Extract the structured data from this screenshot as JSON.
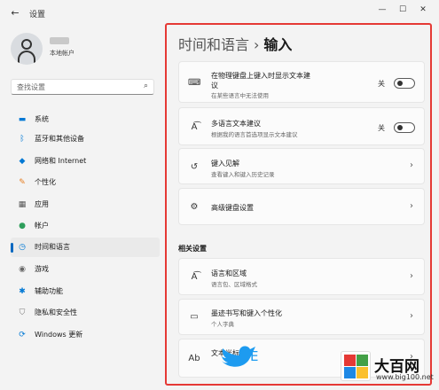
{
  "window": {
    "title": "设置",
    "back_glyph": "←",
    "minimize": "—",
    "maximize": "☐",
    "close": "✕"
  },
  "profile": {
    "sub_label": "本地帐户"
  },
  "search": {
    "placeholder": "查找设置"
  },
  "nav": [
    {
      "label": "系统",
      "icon": "monitor-icon",
      "glyph": "▬",
      "color": "#0078d4",
      "active": false
    },
    {
      "label": "蓝牙和其他设备",
      "icon": "bluetooth-icon",
      "glyph": "ᛒ",
      "color": "#0078d4",
      "active": false
    },
    {
      "label": "网络和 Internet",
      "icon": "wifi-icon",
      "glyph": "◆",
      "color": "#0078d4",
      "active": false
    },
    {
      "label": "个性化",
      "icon": "brush-icon",
      "glyph": "✎",
      "color": "#e67e22",
      "active": false
    },
    {
      "label": "应用",
      "icon": "apps-icon",
      "glyph": "▦",
      "color": "#555555",
      "active": false
    },
    {
      "label": "帐户",
      "icon": "person-icon",
      "glyph": "●",
      "color": "#2e9e5b",
      "active": false
    },
    {
      "label": "时间和语言",
      "icon": "clock-globe-icon",
      "glyph": "◷",
      "color": "#0078d4",
      "active": true
    },
    {
      "label": "游戏",
      "icon": "gamepad-icon",
      "glyph": "◉",
      "color": "#666666",
      "active": false
    },
    {
      "label": "辅助功能",
      "icon": "accessibility-icon",
      "glyph": "✱",
      "color": "#0078d4",
      "active": false
    },
    {
      "label": "隐私和安全性",
      "icon": "shield-icon",
      "glyph": "⛉",
      "color": "#777777",
      "active": false
    },
    {
      "label": "Windows 更新",
      "icon": "update-icon",
      "glyph": "⟳",
      "color": "#0078d4",
      "active": false
    }
  ],
  "breadcrumb": {
    "parent": "时间和语言",
    "separator": "›",
    "current": "输入"
  },
  "cards": [
    {
      "title_line1": "在物理键盘上键入时显示文本建",
      "title_line2": "议",
      "subtitle": "在某些语言中无法使用",
      "icon": "keyboard-icon",
      "glyph": "⌨",
      "toggle_label": "关",
      "has_toggle": true
    },
    {
      "title": "多语言文本建议",
      "subtitle": "根据我的语言首选项显示文本建议",
      "icon": "language-suggest-icon",
      "glyph": "A͡",
      "toggle_label": "关",
      "has_toggle": true
    },
    {
      "title": "键入见解",
      "subtitle": "查看键入和键入历史记录",
      "icon": "history-icon",
      "glyph": "↺",
      "chevron": "›"
    },
    {
      "title": "高级键盘设置",
      "icon": "gear-icon",
      "glyph": "⚙",
      "chevron": "›"
    }
  ],
  "related": {
    "heading": "相关设置",
    "cards": [
      {
        "title": "语言和区域",
        "subtitle": "语言包、区域格式",
        "icon": "language-region-icon",
        "glyph": "A͡",
        "chevron": "›"
      },
      {
        "title": "墨迹书写和键入个性化",
        "subtitle": "个人字典",
        "icon": "ink-icon",
        "glyph": "▭",
        "chevron": "›"
      },
      {
        "title": "文本光标",
        "icon": "text-cursor-icon",
        "glyph": "Ab",
        "chevron": "›"
      }
    ]
  },
  "watermark": {
    "title": "大百网",
    "url": "www.big100.net",
    "bird_char": "E"
  }
}
